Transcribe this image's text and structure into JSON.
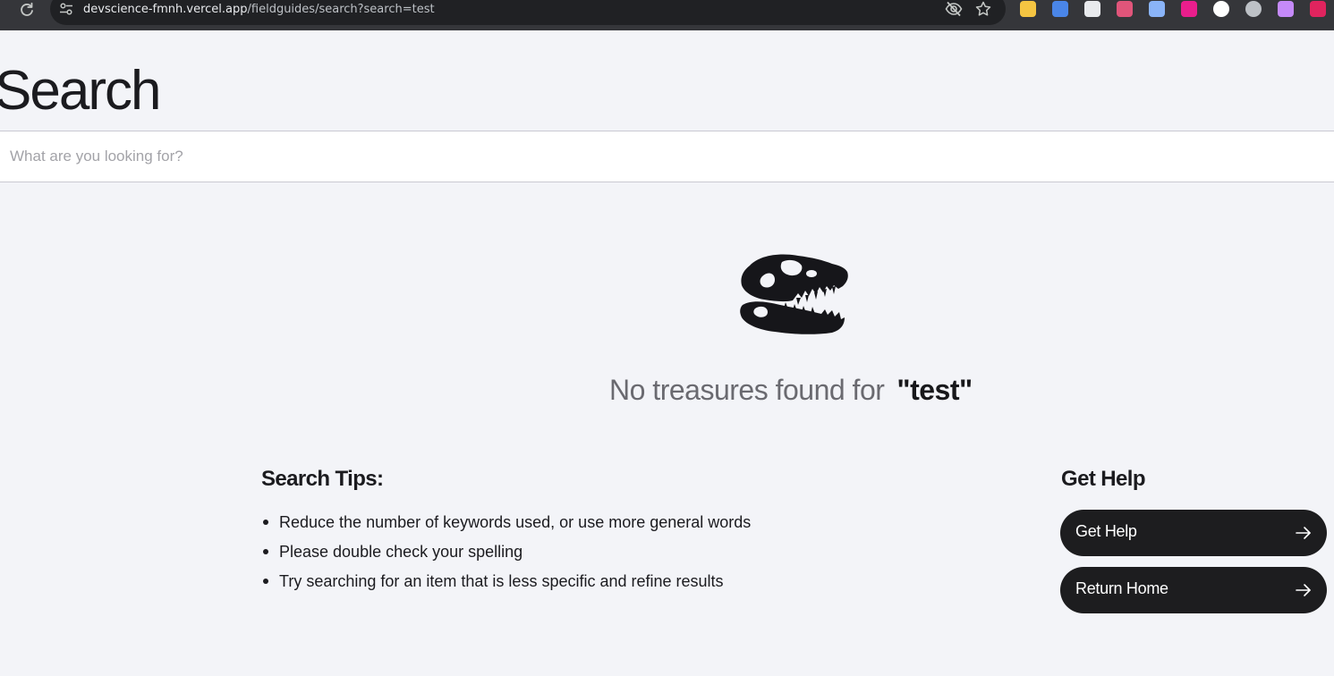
{
  "browser": {
    "url_host": "devscience-fmnh.vercel.app",
    "url_path": "/fieldguides/search?search=test",
    "extensions": [
      {
        "icon": "notes-extension-icon",
        "color": "#f5c542"
      },
      {
        "icon": "docs-extension-icon",
        "color": "#4a86e8"
      },
      {
        "icon": "camera-extension-icon",
        "color": "#e8eaed"
      },
      {
        "icon": "gradient-extension-icon",
        "color": "#e0557a"
      },
      {
        "icon": "eyedropper-extension-icon",
        "color": "#8ab4f8"
      },
      {
        "icon": "video-extension-icon",
        "color": "#e91e8c"
      },
      {
        "icon": "s-extension-icon",
        "color": "#ffffff"
      },
      {
        "icon": "rocket-extension-icon",
        "color": "#bdc1c6"
      },
      {
        "icon": "puzzle-extension-icon",
        "color": "#c58af9"
      },
      {
        "icon": "shield-extension-icon",
        "color": "#e0245e"
      }
    ]
  },
  "page": {
    "title": "Search",
    "search_placeholder": "What are you looking for?",
    "empty_state": {
      "icon": "dinosaur-skull-icon",
      "message": "No treasures found for",
      "query": "\"test\""
    },
    "tips": {
      "heading": "Search Tips:",
      "items": [
        "Reduce the number of keywords used, or use more general words",
        "Please double check your spelling",
        "Try searching for an item that is less specific and refine results"
      ]
    },
    "help": {
      "heading": "Get Help",
      "buttons": [
        {
          "label": "Get Help",
          "icon": "arrow-right-icon"
        },
        {
          "label": "Return Home",
          "icon": "arrow-right-icon"
        }
      ]
    }
  }
}
